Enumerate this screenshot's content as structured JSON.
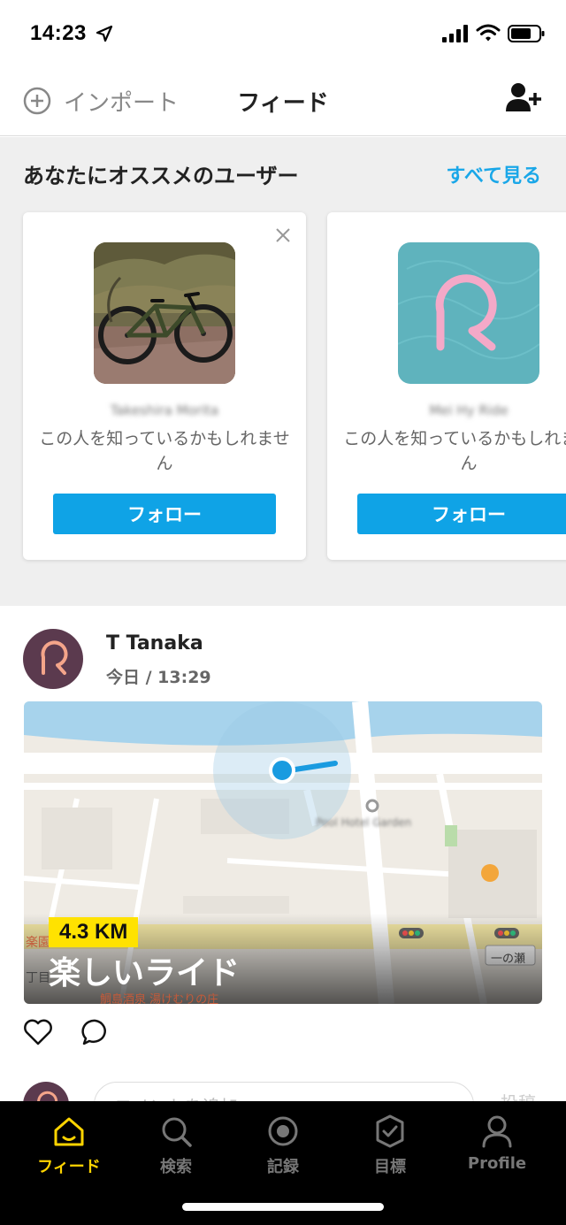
{
  "status_bar": {
    "time": "14:23",
    "icons": [
      "location-arrow-icon",
      "cellular-signal-icon",
      "wifi-icon",
      "battery-icon"
    ]
  },
  "header": {
    "import_label": "インポート",
    "title": "フィード",
    "import_icon": "plus-circle-icon",
    "add_user_icon": "add-user-icon"
  },
  "suggestions": {
    "title": "あなたにオススメのユーザー",
    "see_all": "すべて見る",
    "cards": [
      {
        "name": "Takeshira Morita",
        "description": "この人を知っているかもしれません",
        "follow_label": "フォロー",
        "photo": "bicycle-photo"
      },
      {
        "name": "Mei Hy Ride",
        "description": "この人を知っているかもしれません",
        "follow_label": "フォロー",
        "photo": "app-logo-avatar"
      }
    ]
  },
  "post": {
    "user": "T Tanaka",
    "time": "今日 / 13:29",
    "distance": "4.3 KM",
    "title": "楽しいライド",
    "map_labels": {
      "street": "一の瀬",
      "place": "Pool Hotel Garden",
      "left_block": "楽園",
      "left_block_2": "丁目",
      "restaurant": "鯛島酒泉 湯けむりの庄"
    },
    "comment_placeholder": "コメントを追加",
    "comment_post": "投稿"
  },
  "tabs": [
    {
      "label": "フィード",
      "icon": "home-icon",
      "active": true
    },
    {
      "label": "検索",
      "icon": "search-icon",
      "active": false
    },
    {
      "label": "記録",
      "icon": "record-icon",
      "active": false
    },
    {
      "label": "目標",
      "icon": "goal-badge-icon",
      "active": false
    },
    {
      "label": "Profile",
      "icon": "profile-icon",
      "active": false
    }
  ],
  "colors": {
    "accent_blue": "#0fa3e6",
    "tab_active": "#ffd400",
    "km_badge": "#ffe200",
    "avatar_bg": "#5b3a4e",
    "logo_bg": "#5fb3bd",
    "logo_pink": "#f4a9c8"
  }
}
